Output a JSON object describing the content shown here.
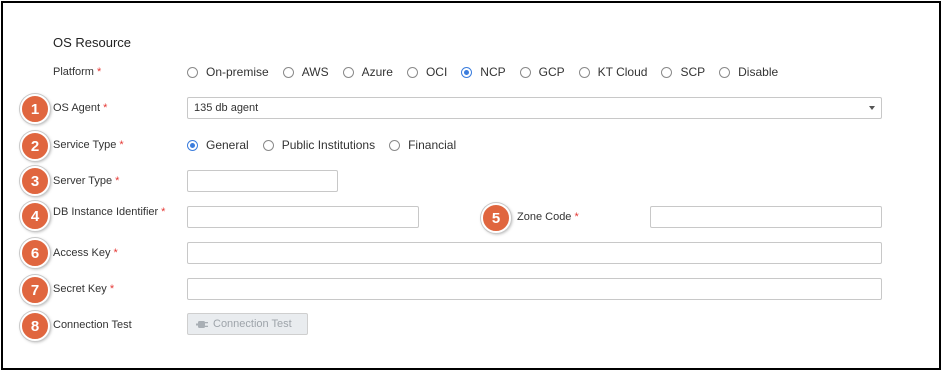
{
  "section_title": "OS Resource",
  "required_mark": "*",
  "accent_color": "#3b7ddd",
  "badge_color": "#e0663f",
  "platform": {
    "label": "Platform",
    "options": [
      "On-premise",
      "AWS",
      "Azure",
      "OCI",
      "NCP",
      "GCP",
      "KT Cloud",
      "SCP",
      "Disable"
    ],
    "selected": "NCP"
  },
  "os_agent": {
    "badge": "1",
    "label": "OS Agent",
    "value": "135 db agent"
  },
  "service_type": {
    "badge": "2",
    "label": "Service Type",
    "options": [
      "General",
      "Public Institutions",
      "Financial"
    ],
    "selected": "General"
  },
  "server_type": {
    "badge": "3",
    "label": "Server Type",
    "value": ""
  },
  "db_instance": {
    "badge": "4",
    "label": "DB Instance Identifier",
    "value": ""
  },
  "zone_code": {
    "badge": "5",
    "label": "Zone Code",
    "value": ""
  },
  "access_key": {
    "badge": "6",
    "label": "Access Key",
    "value": ""
  },
  "secret_key": {
    "badge": "7",
    "label": "Secret Key",
    "value": ""
  },
  "connection_test": {
    "badge": "8",
    "label": "Connection Test",
    "button_label": "Connection Test",
    "button_icon": "plug-icon"
  }
}
